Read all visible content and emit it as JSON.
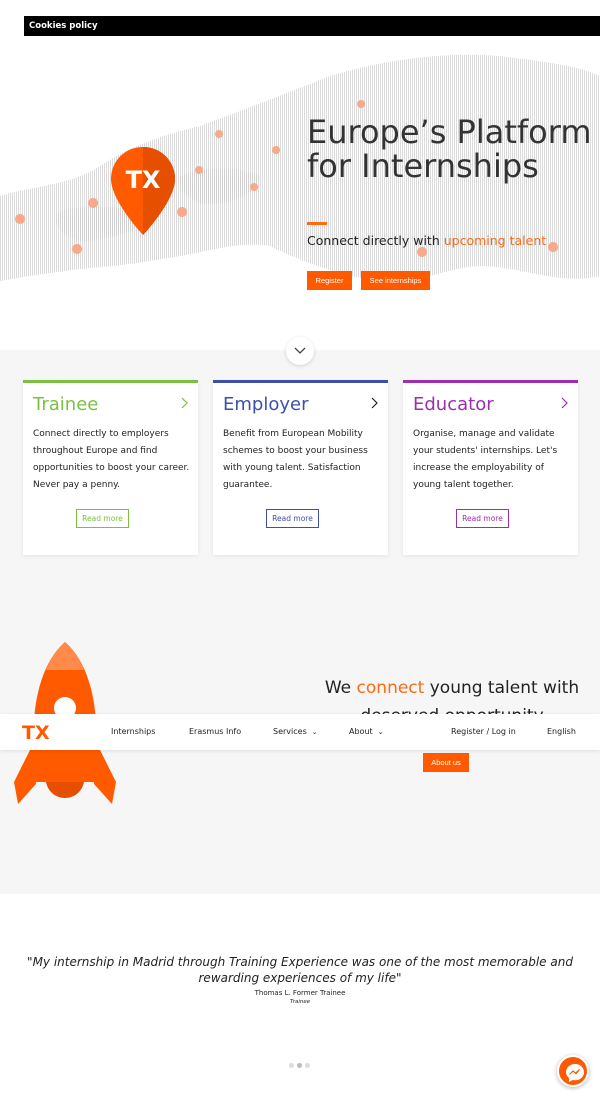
{
  "cookie_bar": {
    "label": "Cookies policy"
  },
  "hero": {
    "title": "Europe’s Platform for Internships",
    "subtitle_prefix": "Connect directly with ",
    "subtitle_accent": "upcoming talent",
    "register_label": "Register",
    "see_internships_label": "See internships"
  },
  "cards": [
    {
      "title": "Trainee",
      "text": "Connect directly to employers throughout Europe and find opportunities to boost your career. Never pay a penny.",
      "button": "Read more",
      "color": "#7cc043"
    },
    {
      "title": "Employer",
      "text": "Benefit from European Mobility schemes to boost your business with young talent. Satisfaction guarantee.",
      "button": "Read more",
      "color": "#3f4fa8"
    },
    {
      "title": "Educator",
      "text": "Organise, manage and validate your students' internships. Let's increase the employability of young talent together.",
      "button": "Read more",
      "color": "#9b2fae"
    }
  ],
  "connect": {
    "prefix": "We ",
    "accent": "connect",
    "suffix": " young talent with deserved opportunity",
    "about_label": "About us"
  },
  "nav": {
    "logo": "TX",
    "items": [
      "Internships",
      "Erasmus Info",
      "Services",
      "About",
      "Register / Log in",
      "English"
    ]
  },
  "testimonial": {
    "quote": "\"My internship in Madrid through Training Experience was one of the most memorable and rewarding experiences of my life\"",
    "author": "Thomas L. Former Trainee",
    "role": "Trainee"
  },
  "colors": {
    "accent": "#ff5a00",
    "trainee": "#7cc043",
    "employer": "#3f4fa8",
    "educator": "#9b2fae"
  },
  "icons": {
    "scroll": "chevron-down-icon",
    "card_arrow": "chevron-right-icon",
    "chat": "messenger-icon"
  }
}
